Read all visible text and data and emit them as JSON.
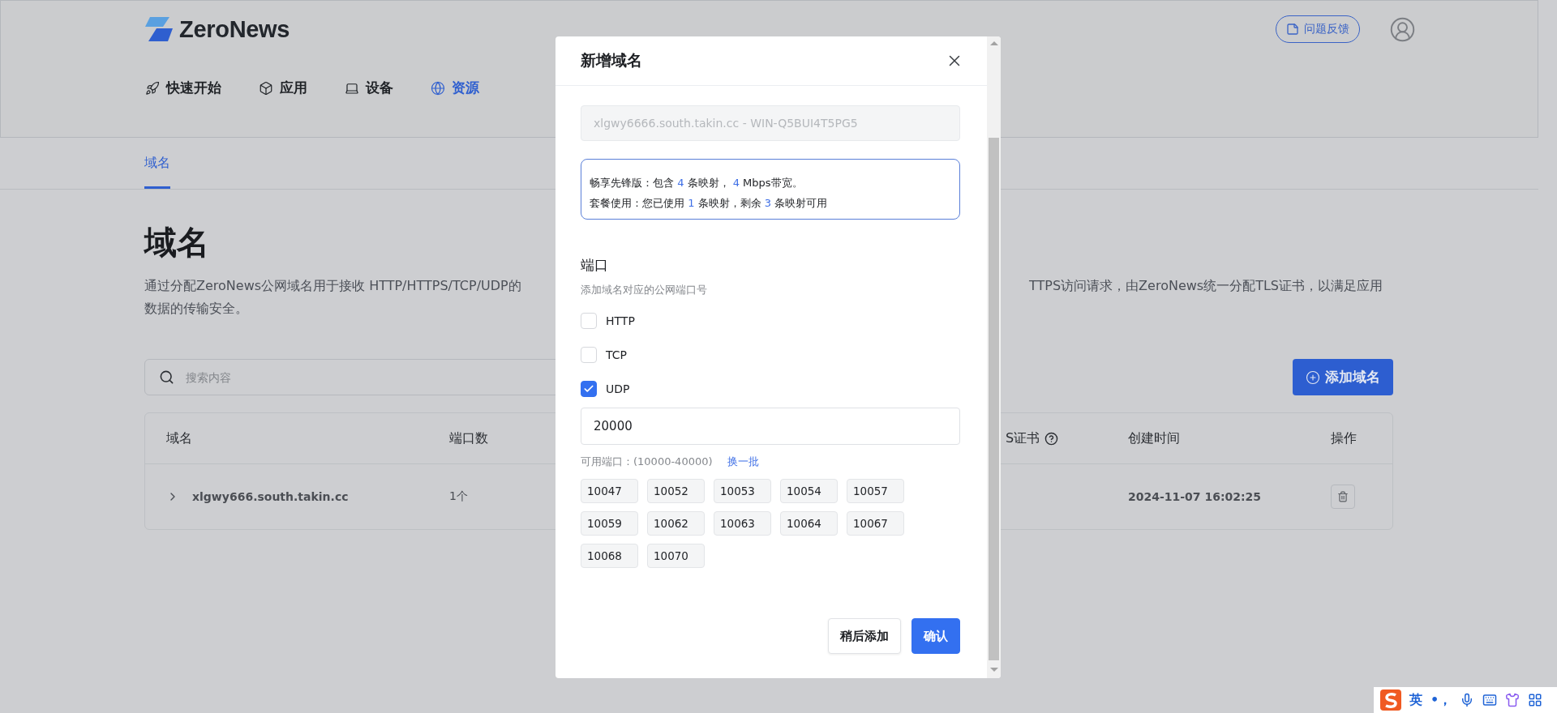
{
  "header": {
    "logo": "ZeroNews",
    "nav": [
      {
        "label": "快速开始",
        "selected": false
      },
      {
        "label": "应用",
        "selected": false
      },
      {
        "label": "设备",
        "selected": false
      },
      {
        "label": "资源",
        "selected": true
      }
    ],
    "feedback": "问题反馈"
  },
  "tabs": [
    {
      "label": "域名",
      "selected": true
    }
  ],
  "page": {
    "title": "域名",
    "description_left": "通过分配ZeroNews公网域名用于接收 HTTP/HTTPS/TCP/UDP的",
    "description_right": "TTPS访问请求，由ZeroNews统一分配TLS证书，以满足应用",
    "description_line2": "数据的传输安全。"
  },
  "search": {
    "placeholder": "搜索内容"
  },
  "add_button": "添加域名",
  "table": {
    "columns": [
      {
        "label": "域名",
        "help": false
      },
      {
        "label": "端口数",
        "help": false
      },
      {
        "label": "S证书",
        "help": true
      },
      {
        "label": "创建时间",
        "help": false
      },
      {
        "label": "操作",
        "help": false
      }
    ],
    "rows": [
      {
        "domain": "xlgwy666.south.takin.cc",
        "ports": "1个",
        "created": "2024-11-07 16:02:25",
        "expanded": false
      }
    ]
  },
  "dialog": {
    "title": "新增域名",
    "domain_value": "xlgwy6666.south.takin.cc - WIN-Q5BUI4T5PG5",
    "plan_lines": [
      [
        {
          "text": "畅享先锋版：包含 ",
          "highlight": false
        },
        {
          "text": "4",
          "highlight": true
        },
        {
          "text": " 条映射， ",
          "highlight": false
        },
        {
          "text": "4",
          "highlight": true
        },
        {
          "text": " Mbps带宽。",
          "highlight": false
        }
      ],
      [
        {
          "text": "套餐使用：您已使用 ",
          "highlight": false
        },
        {
          "text": "1",
          "highlight": true
        },
        {
          "text": " 条映射，剩余 ",
          "highlight": false
        },
        {
          "text": "3",
          "highlight": true
        },
        {
          "text": " 条映射可用",
          "highlight": false
        }
      ]
    ],
    "port_label": "端口",
    "port_hint": "添加域名对应的公网端口号",
    "protocols": [
      {
        "label": "HTTP",
        "checked": false
      },
      {
        "label": "TCP",
        "checked": false
      },
      {
        "label": "UDP",
        "checked": true
      }
    ],
    "port_input": {
      "value": "20000"
    },
    "available_label": "可用端口：",
    "available_range": "(10000-40000)",
    "refresh_link": "换一批",
    "ports": [
      "10047",
      "10052",
      "10053",
      "10054",
      "10057",
      "10059",
      "10062",
      "10063",
      "10064",
      "10067",
      "10068",
      "10070"
    ],
    "buttons": [
      {
        "label": "稍后添加",
        "kind": "secondary"
      },
      {
        "label": "确认",
        "kind": "primary"
      }
    ]
  },
  "ime_bar": {
    "mode": "英",
    "punct": "•，"
  }
}
